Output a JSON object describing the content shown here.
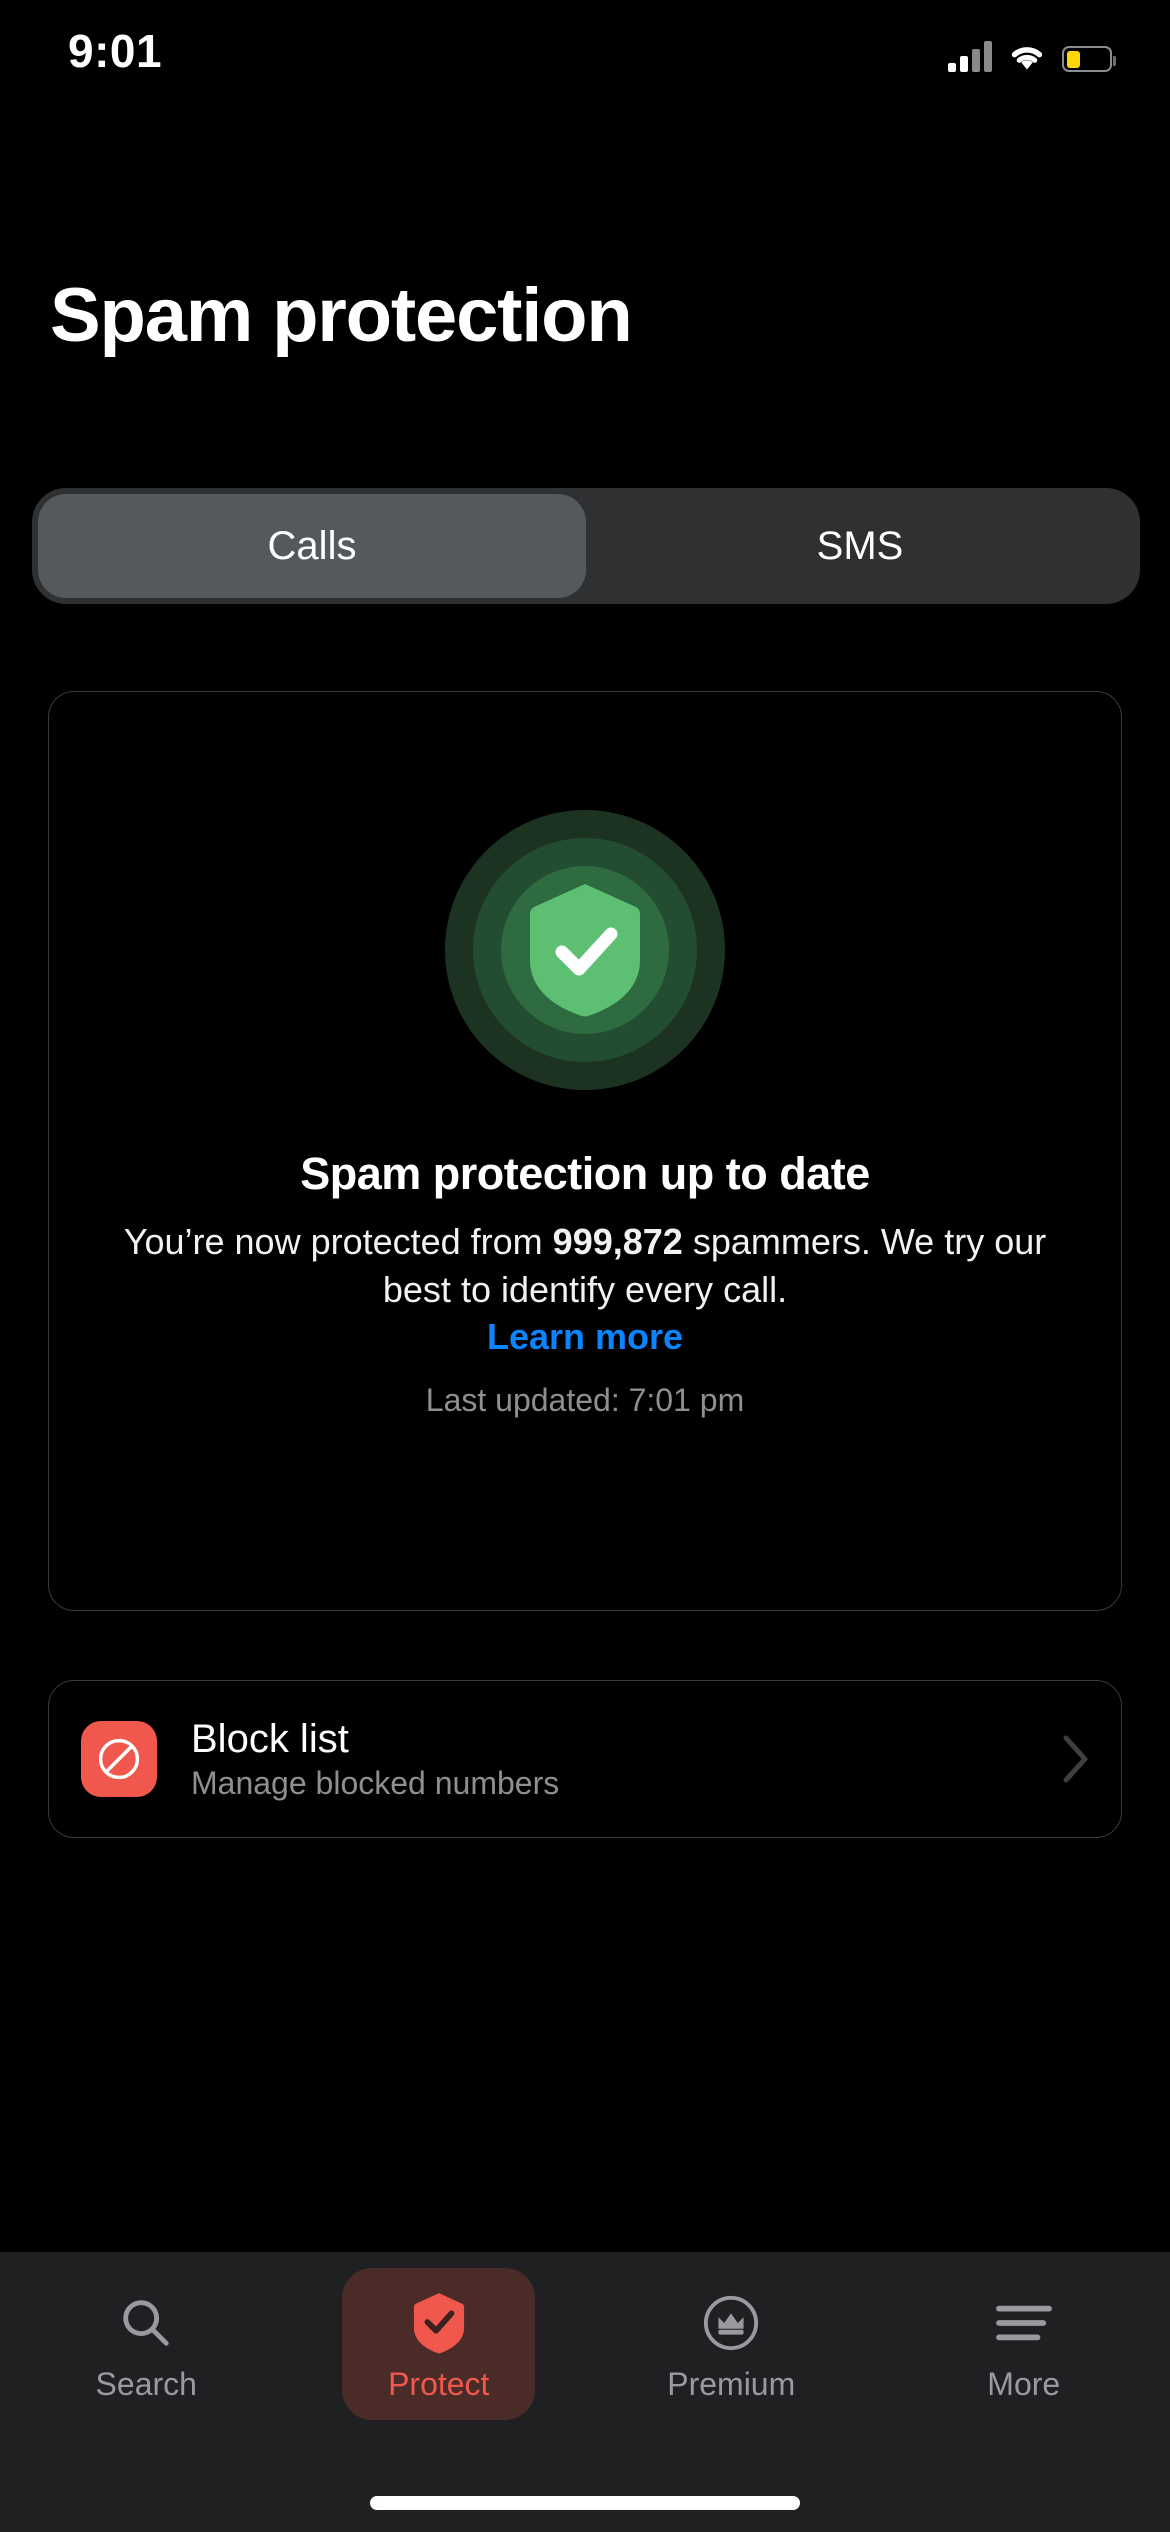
{
  "status_bar": {
    "time": "9:01",
    "cellular_icon": "signal-bars-icon",
    "cellular_bars_filled": 2,
    "cellular_bars_total": 4,
    "wifi_icon": "wifi-icon",
    "battery_icon": "battery-low-icon",
    "battery_level_percent": 34,
    "battery_color": "#FFD60A"
  },
  "header": {
    "title": "Spam protection"
  },
  "segmented_control": {
    "selected": "Calls",
    "options": [
      {
        "label": "Calls",
        "active": true
      },
      {
        "label": "SMS",
        "active": false
      }
    ]
  },
  "status_card": {
    "hero_icon": "shield-check-icon",
    "hero_colors": {
      "ring_outer": "#1c3322",
      "ring_middle": "#234d31",
      "ring_inner": "#2f6b41",
      "shield": "#5CBF72",
      "check": "#ffffff"
    },
    "heading": "Spam protection up to date",
    "body_prefix": "You’re now protected from ",
    "body_count": "999,872",
    "body_suffix": " spammers. We try our best to identify every call.",
    "learn_more_label": "Learn more",
    "learn_more_color": "#0A84FF",
    "last_updated": "Last updated: 7:01 pm"
  },
  "block_list_row": {
    "icon": "prohibited-circle-icon",
    "icon_bg": "#F0584D",
    "title": "Block list",
    "subtitle": "Manage blocked numbers",
    "chevron_icon": "chevron-right-icon"
  },
  "tab_bar": {
    "active_color": "#F0584D",
    "inactive_color": "#9a9a9e",
    "items": [
      {
        "label": "Search",
        "icon": "search-icon",
        "active": false
      },
      {
        "label": "Protect",
        "icon": "shield-check-icon",
        "active": true
      },
      {
        "label": "Premium",
        "icon": "crown-circle-icon",
        "active": false
      },
      {
        "label": "More",
        "icon": "hamburger-menu-icon",
        "active": false
      }
    ]
  },
  "home_indicator": {
    "visible": true
  }
}
